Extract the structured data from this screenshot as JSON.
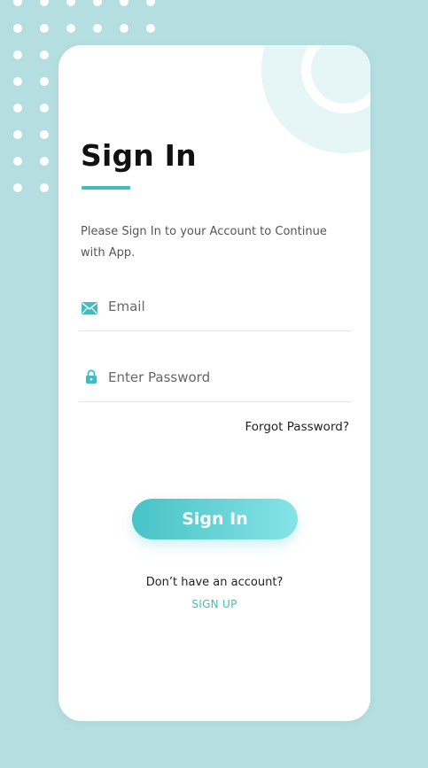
{
  "signin": {
    "title": "Sign In",
    "subtitle": "Please Sign In to your Account to Continue with App.",
    "email_placeholder": "Email",
    "password_placeholder": "Enter Password",
    "forgot_label": "Forgot Password?",
    "button_label": "Sign In",
    "no_account_text": "Don’t have an account?",
    "signup_label": "SIGN UP"
  },
  "icons": {
    "email": "envelope-icon",
    "password": "lock-icon"
  },
  "colors": {
    "background": "#b5dee1",
    "card": "#ffffff",
    "accent": "#3fbdc1",
    "button_gradient_start": "#47c3c6",
    "button_gradient_end": "#86e3e6",
    "decoration": "#e6f6f7"
  }
}
